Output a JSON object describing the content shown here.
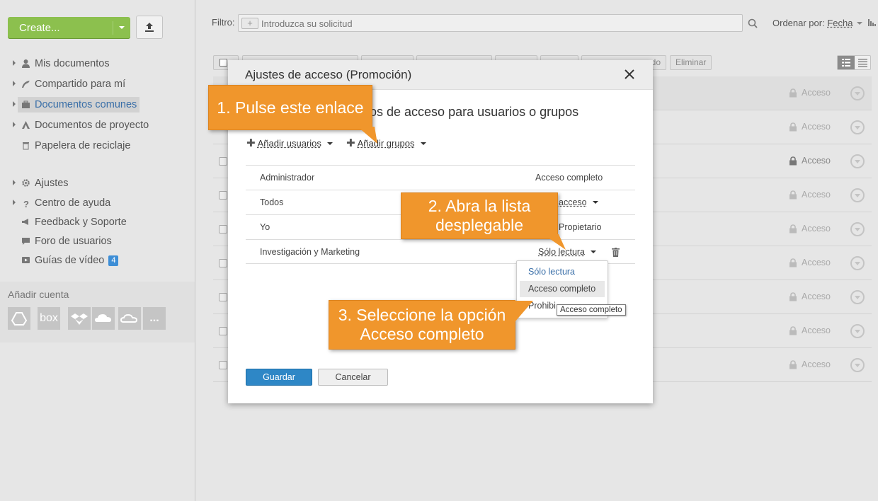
{
  "sidebar": {
    "create_label": "Create...",
    "nav": [
      {
        "label": "Mis documentos",
        "icon": "user-icon"
      },
      {
        "label": "Compartido para mí",
        "icon": "share-icon"
      },
      {
        "label": "Documentos comunes",
        "icon": "briefcase-icon"
      },
      {
        "label": "Documentos de proyecto",
        "icon": "project-icon"
      },
      {
        "label": "Papelera de reciclaje",
        "icon": "trash-icon"
      },
      {
        "label": "Ajustes",
        "icon": "gear-icon"
      },
      {
        "label": "Centro de ayuda",
        "icon": "question-icon"
      },
      {
        "label": "Feedback y Soporte",
        "icon": "megaphone-icon"
      },
      {
        "label": "Foro de usuarios",
        "icon": "chat-icon"
      },
      {
        "label": "Guías de vídeo",
        "icon": "video-icon",
        "badge": "4"
      }
    ],
    "add_account_label": "Añadir cuenta",
    "accounts": [
      "google-drive-icon",
      "box",
      "dropbox-icon",
      "onedrive-icon",
      "cloud-icon",
      "..."
    ]
  },
  "main": {
    "filter_label": "Filtro:",
    "filter_placeholder": "Introduzca su solicitud",
    "sort_label": "Ordenar por:",
    "sort_value": "Fecha",
    "toolbar_partial": "do",
    "toolbar_delete": "Eliminar",
    "row_access_label": "Acceso"
  },
  "dialog": {
    "title": "Ajustes de acceso (Promoción)",
    "subtitle_partial": "os de acceso para usuarios o grupos",
    "add_users": "Añadir usuarios",
    "add_groups": "Añadir grupos",
    "rows": [
      {
        "name": "Administrador",
        "level": "Acceso completo"
      },
      {
        "name": "Todos",
        "level": "acceso"
      },
      {
        "name": "Yo",
        "level": "Propietario"
      },
      {
        "name": "Investigación y Marketing",
        "level": "Sólo lectura"
      }
    ],
    "options": [
      "Sólo lectura",
      "Acceso completo",
      "Prohibi"
    ],
    "tooltip": "Acceso completo",
    "save_label": "Guardar",
    "cancel_label": "Cancelar"
  },
  "callouts": {
    "step1": "1. Pulse este enlace",
    "step2_line1": "2. Abra la lista",
    "step2_line2": "desplegable",
    "step3_line1": "3. Seleccione la opción",
    "step3_line2": "Acceso completo"
  },
  "colors": {
    "create_green": "#8cc04e",
    "save_blue": "#2e87c6",
    "callout_orange": "#f0962c",
    "active_link": "#3a6fa8"
  }
}
